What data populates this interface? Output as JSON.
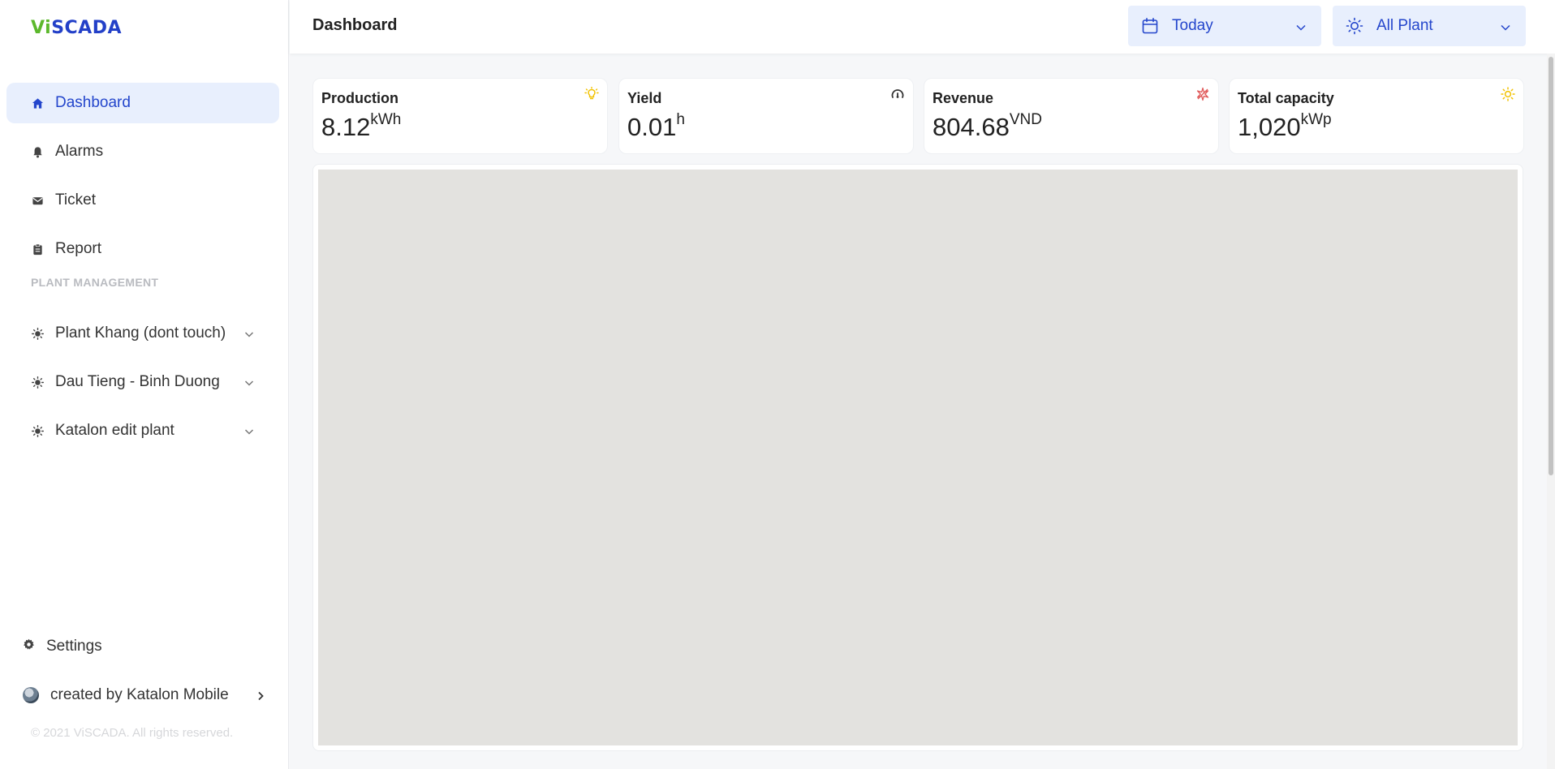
{
  "brand": {
    "logo_v": "Vi",
    "logo_rest": "SCADA"
  },
  "sidebar": {
    "items": [
      {
        "label": "Dashboard",
        "icon": "home-icon",
        "active": true
      },
      {
        "label": "Alarms",
        "icon": "bell-icon"
      },
      {
        "label": "Ticket",
        "icon": "mail-icon"
      },
      {
        "label": "Report",
        "icon": "clipboard-icon"
      }
    ],
    "section_label": "PLANT MANAGEMENT",
    "plants": [
      {
        "label": "Plant Khang (dont touch)",
        "icon": "sun-icon"
      },
      {
        "label": "Dau Tieng - Binh Duong",
        "icon": "sun-icon"
      },
      {
        "label": "Katalon edit plant",
        "icon": "sun-icon"
      }
    ],
    "settings_label": "Settings",
    "user_label": "created by Katalon Mobile",
    "copyright": "© 2021 ViSCADA. All rights reserved."
  },
  "header": {
    "title": "Dashboard",
    "date_select": "Today",
    "plant_select": "All Plant"
  },
  "cards": [
    {
      "label": "Production",
      "value": "8.12",
      "unit": "kWh",
      "icon": "lightbulb-icon",
      "icon_color": "#f2c200"
    },
    {
      "label": "Yield",
      "value": "0.01",
      "unit": "h",
      "icon": "gauge-icon",
      "icon_color": "#333333"
    },
    {
      "label": "Revenue",
      "value": "804.68",
      "unit": "VND",
      "icon": "sparkle-icon",
      "icon_color": "#e05a5a"
    },
    {
      "label": "Total capacity",
      "value": "1,020",
      "unit": "kWp",
      "icon": "sun-icon",
      "icon_color": "#f2c200"
    }
  ],
  "colors": {
    "accent": "#2446cc",
    "active_bg": "#e8effd",
    "logo_green": "#5cb82c"
  }
}
